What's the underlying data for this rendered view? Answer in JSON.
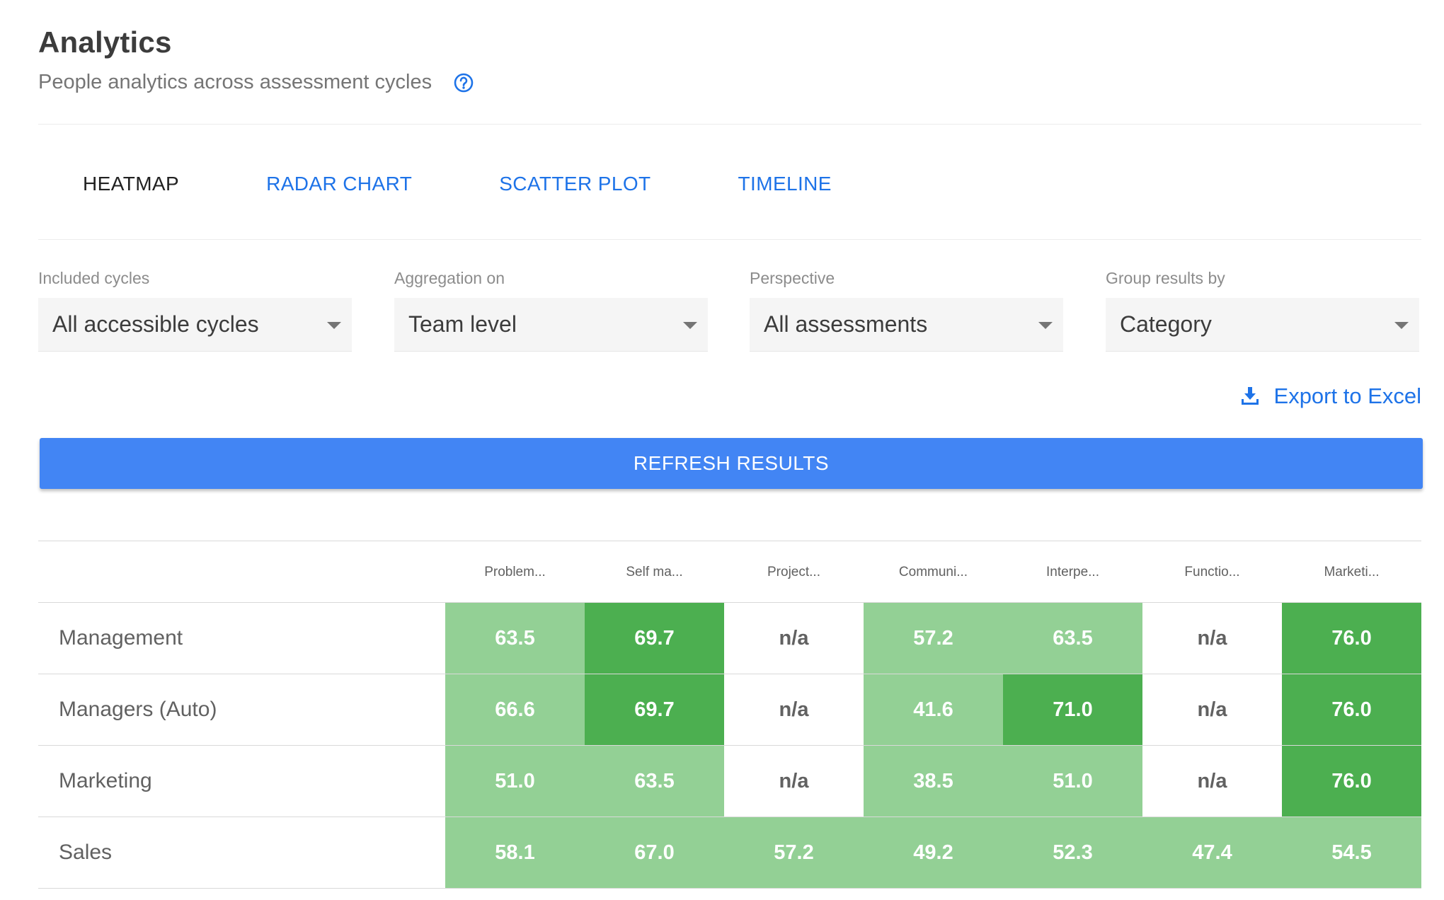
{
  "header": {
    "title": "Analytics",
    "subtitle": "People analytics across assessment cycles"
  },
  "tabs": [
    {
      "label": "HEATMAP",
      "active": true
    },
    {
      "label": "RADAR CHART",
      "active": false
    },
    {
      "label": "SCATTER PLOT",
      "active": false
    },
    {
      "label": "TIMELINE",
      "active": false
    }
  ],
  "filters": {
    "cycles": {
      "label": "Included cycles",
      "value": "All accessible cycles"
    },
    "aggregation": {
      "label": "Aggregation on",
      "value": "Team level"
    },
    "perspective": {
      "label": "Perspective",
      "value": "All assessments"
    },
    "group_by": {
      "label": "Group results by",
      "value": "Category"
    }
  },
  "export": {
    "label": "Export to Excel"
  },
  "refresh": {
    "label": "REFRESH RESULTS"
  },
  "colors": {
    "accent": "#1e73e8",
    "button": "#4285f4",
    "cell_light": "#93d095",
    "cell_dark": "#4caf50"
  },
  "heatmap": {
    "columns": [
      "Problem...",
      "Self ma...",
      "Project...",
      "Communi...",
      "Interpe...",
      "Functio...",
      "Marketi..."
    ],
    "rows": [
      {
        "label": "Management",
        "cells": [
          {
            "value": "63.5",
            "level": "light"
          },
          {
            "value": "69.7",
            "level": "dark"
          },
          {
            "value": "n/a",
            "level": "none"
          },
          {
            "value": "57.2",
            "level": "light"
          },
          {
            "value": "63.5",
            "level": "light"
          },
          {
            "value": "n/a",
            "level": "none"
          },
          {
            "value": "76.0",
            "level": "dark"
          }
        ]
      },
      {
        "label": "Managers (Auto)",
        "cells": [
          {
            "value": "66.6",
            "level": "light"
          },
          {
            "value": "69.7",
            "level": "dark"
          },
          {
            "value": "n/a",
            "level": "none"
          },
          {
            "value": "41.6",
            "level": "light"
          },
          {
            "value": "71.0",
            "level": "dark"
          },
          {
            "value": "n/a",
            "level": "none"
          },
          {
            "value": "76.0",
            "level": "dark"
          }
        ]
      },
      {
        "label": "Marketing",
        "cells": [
          {
            "value": "51.0",
            "level": "light"
          },
          {
            "value": "63.5",
            "level": "light"
          },
          {
            "value": "n/a",
            "level": "none"
          },
          {
            "value": "38.5",
            "level": "light"
          },
          {
            "value": "51.0",
            "level": "light"
          },
          {
            "value": "n/a",
            "level": "none"
          },
          {
            "value": "76.0",
            "level": "dark"
          }
        ]
      },
      {
        "label": "Sales",
        "cells": [
          {
            "value": "58.1",
            "level": "light"
          },
          {
            "value": "67.0",
            "level": "light"
          },
          {
            "value": "57.2",
            "level": "light"
          },
          {
            "value": "49.2",
            "level": "light"
          },
          {
            "value": "52.3",
            "level": "light"
          },
          {
            "value": "47.4",
            "level": "light"
          },
          {
            "value": "54.5",
            "level": "light"
          }
        ]
      }
    ]
  }
}
